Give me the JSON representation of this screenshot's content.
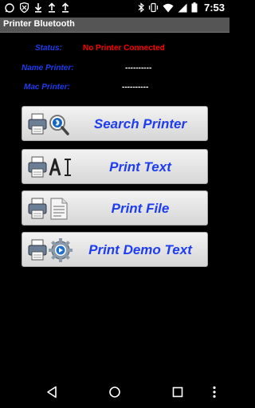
{
  "status_bar": {
    "time": "7:53",
    "icons": [
      "whatsapp-icon",
      "shield-icon",
      "download-icon",
      "upload-icon",
      "upload-icon",
      "bluetooth-icon",
      "vibrate-icon",
      "wifi-icon",
      "signal-icon",
      "battery-icon"
    ]
  },
  "app_bar": {
    "title": "Printer Bluetooth"
  },
  "info": {
    "status_label": "Status:",
    "status_value": "No Printer Connected",
    "status_color": "#ff0000",
    "name_label": "Name Printer:",
    "name_value": "----------",
    "mac_label": "Mac Printer:",
    "mac_value": "----------"
  },
  "buttons": [
    {
      "label": "Search Printer",
      "icon": "printer-bluetooth-search-icon"
    },
    {
      "label": "Print Text",
      "icon": "printer-text-icon"
    },
    {
      "label": "Print File",
      "icon": "printer-file-icon"
    },
    {
      "label": "Print Demo Text",
      "icon": "printer-gear-icon"
    }
  ],
  "nav_bar": {
    "icons": [
      "back-icon",
      "home-icon",
      "recents-icon",
      "more-icon"
    ]
  },
  "colors": {
    "accent": "#1e3cf0",
    "background": "#000000",
    "appbar": "#555555"
  }
}
